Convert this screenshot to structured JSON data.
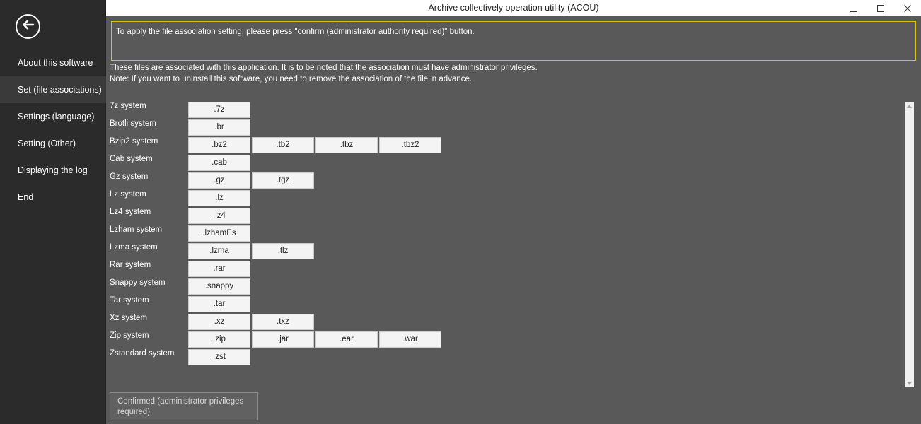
{
  "window": {
    "title": "Archive collectively operation utility (ACOU)"
  },
  "sidebar": {
    "back_icon": "back-arrow-icon",
    "items": [
      {
        "label": "About this software",
        "active": false
      },
      {
        "label": "Set (file associations)",
        "active": true
      },
      {
        "label": "Settings (language)",
        "active": false
      },
      {
        "label": "Setting (Other)",
        "active": false
      },
      {
        "label": "Displaying the log",
        "active": false
      },
      {
        "label": "End",
        "active": false
      }
    ]
  },
  "notice": {
    "text": "To apply the file association setting, please press \"confirm (administrator authority required)\" button."
  },
  "info": {
    "line1": "These files are associated with this application. It is to be noted that the association must have administrator privileges.",
    "line2": "Note: If you want to uninstall this software, you need to remove the association of the file in advance."
  },
  "associations": [
    {
      "label": "7z system",
      "exts": [
        ".7z"
      ]
    },
    {
      "label": "Brotli system",
      "exts": [
        ".br"
      ]
    },
    {
      "label": "Bzip2 system",
      "exts": [
        ".bz2",
        ".tb2",
        ".tbz",
        ".tbz2"
      ]
    },
    {
      "label": "Cab system",
      "exts": [
        ".cab"
      ]
    },
    {
      "label": "Gz system",
      "exts": [
        ".gz",
        ".tgz"
      ]
    },
    {
      "label": "Lz system",
      "exts": [
        ".lz"
      ]
    },
    {
      "label": "Lz4 system",
      "exts": [
        ".lz4"
      ]
    },
    {
      "label": "Lzham system",
      "exts": [
        ".lzhamEs"
      ]
    },
    {
      "label": "Lzma system",
      "exts": [
        ".lzma",
        ".tlz"
      ]
    },
    {
      "label": "Rar system",
      "exts": [
        ".rar"
      ]
    },
    {
      "label": "Snappy system",
      "exts": [
        ".snappy"
      ]
    },
    {
      "label": "Tar system",
      "exts": [
        ".tar"
      ]
    },
    {
      "label": "Xz system",
      "exts": [
        ".xz",
        ".txz"
      ]
    },
    {
      "label": "Zip system",
      "exts": [
        ".zip",
        ".jar",
        ".ear",
        ".war"
      ]
    },
    {
      "label": "Zstandard system",
      "exts": [
        ".zst"
      ]
    }
  ],
  "confirm_button": {
    "label": "Confirmed (administrator privileges required)"
  },
  "colors": {
    "notice_border": "#d6c200",
    "panel_bg": "#595959",
    "sidebar_bg": "#2b2b2b"
  }
}
